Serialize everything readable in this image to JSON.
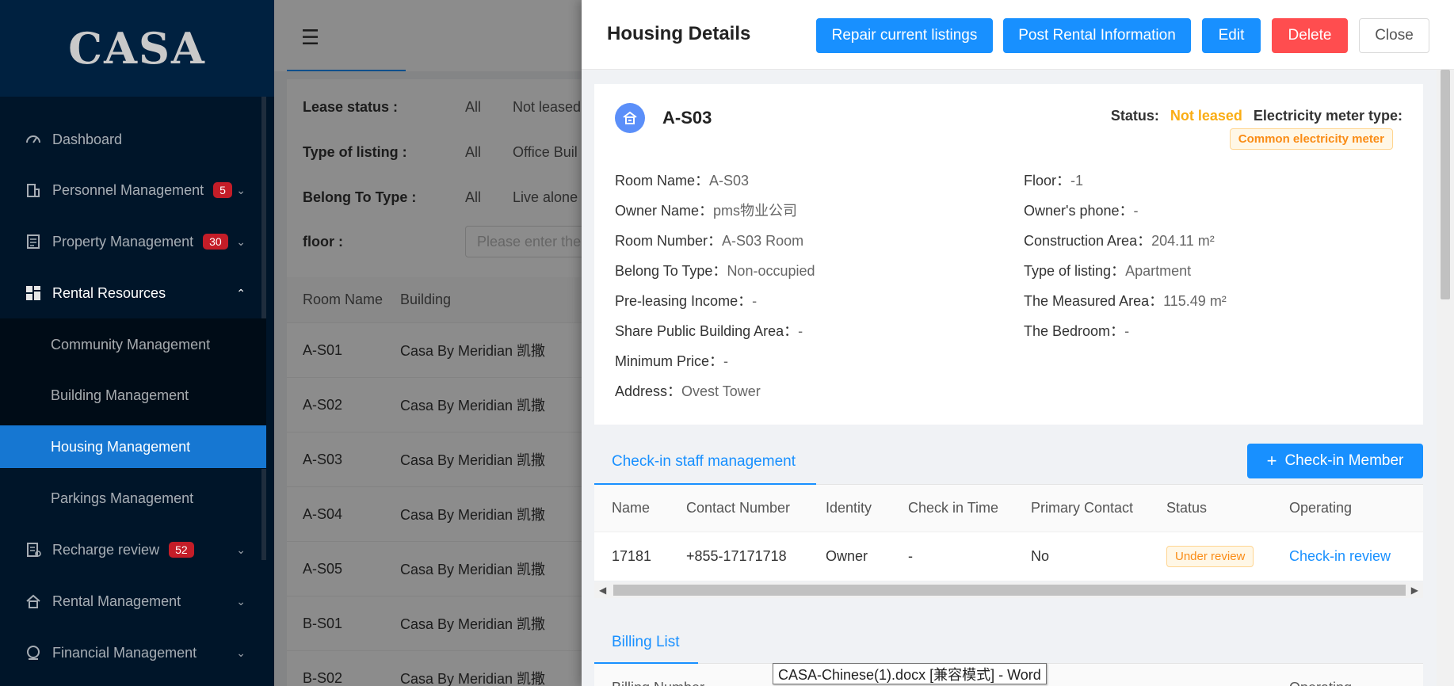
{
  "sidebar": {
    "logo": "CASA",
    "menu": [
      {
        "label": "Dashboard",
        "badge": "",
        "icon": "dashboard-icon"
      },
      {
        "label": "Personnel Management",
        "badge": "5",
        "icon": "building-icon"
      },
      {
        "label": "Property Management",
        "badge": "30",
        "icon": "document-icon"
      },
      {
        "label": "Rental Resources",
        "badge": "",
        "icon": "grid-icon"
      },
      {
        "label": "Recharge review",
        "badge": "52",
        "icon": "receipt-icon"
      },
      {
        "label": "Rental Management",
        "badge": "",
        "icon": "house-icon"
      },
      {
        "label": "Financial Management",
        "badge": "",
        "icon": "finance-icon"
      }
    ],
    "submenu": [
      {
        "label": "Community Management"
      },
      {
        "label": "Building Management"
      },
      {
        "label": "Housing Management"
      },
      {
        "label": "Parkings Management"
      }
    ]
  },
  "filters": {
    "lease_status": {
      "label": "Lease status :",
      "options": [
        "All",
        "Not leased"
      ]
    },
    "listing_type": {
      "label": "Type of listing :",
      "options": [
        "All",
        "Office Buil"
      ]
    },
    "belong_type": {
      "label": "Belong To Type :",
      "options": [
        "All",
        "Live alone"
      ]
    },
    "floor": {
      "label": "floor :",
      "placeholder": "Please enter the"
    }
  },
  "list": {
    "headers": [
      "Room Name",
      "Building"
    ],
    "rows": [
      {
        "room": "A-S01",
        "building": "Casa By Meridian 凯撒"
      },
      {
        "room": "A-S02",
        "building": "Casa By Meridian 凯撒"
      },
      {
        "room": "A-S03",
        "building": "Casa By Meridian 凯撒"
      },
      {
        "room": "A-S04",
        "building": "Casa By Meridian 凯撒"
      },
      {
        "room": "A-S05",
        "building": "Casa By Meridian 凯撒"
      },
      {
        "room": "B-S01",
        "building": "Casa By Meridian 凯撒"
      },
      {
        "room": "B-S02",
        "building": "Casa By Meridian 凯撒"
      }
    ]
  },
  "drawer": {
    "title": "Housing Details",
    "buttons": {
      "repair": "Repair current listings",
      "post": "Post Rental Information",
      "edit": "Edit",
      "delete": "Delete",
      "close": "Close"
    },
    "room_title": "A-S03",
    "status_label": "Status:",
    "status_value": "Not leased",
    "meter_label": "Electricity meter type:",
    "meter_value": "Common electricity meter",
    "fields_left": [
      {
        "label": "Room Name：",
        "value": "A-S03"
      },
      {
        "label": "Owner Name：",
        "value": "pms物业公司"
      },
      {
        "label": "Room Number：",
        "value": "A-S03 Room"
      },
      {
        "label": "Belong To Type：",
        "value": "Non-occupied"
      },
      {
        "label": "Pre-leasing Income：",
        "value": "-"
      },
      {
        "label": "Share Public Building Area：",
        "value": "-"
      },
      {
        "label": "Minimum Price：",
        "value": "-"
      },
      {
        "label": "Address：",
        "value": "Ovest Tower"
      }
    ],
    "fields_right": [
      {
        "label": "Floor：",
        "value": "-1"
      },
      {
        "label": "Owner's phone：",
        "value": "-"
      },
      {
        "label": "Construction Area：",
        "value": "204.11 m²"
      },
      {
        "label": "Type of listing：",
        "value": "Apartment"
      },
      {
        "label": "The Measured Area：",
        "value": "115.49 m²"
      },
      {
        "label": "The Bedroom：",
        "value": "-"
      }
    ],
    "staff": {
      "tab": "Check-in staff management",
      "add_button": "Check-in Member",
      "headers": [
        "Name",
        "Contact Number",
        "Identity",
        "Check in Time",
        "Primary Contact",
        "Status",
        "Operating"
      ],
      "rows": [
        {
          "name": "17181",
          "phone": "+855-17171718",
          "identity": "Owner",
          "time": "-",
          "primary": "No",
          "status": "Under review",
          "op": "Check-in review"
        }
      ]
    },
    "billing": {
      "tab": "Billing List",
      "headers": [
        "Billing Number",
        "Operating"
      ]
    }
  },
  "taskbar_tooltip": "CASA-Chinese(1).docx [兼容模式] - Word",
  "colors": {
    "primary": "#1890ff",
    "danger": "#ff4d4f",
    "warning": "#faad14",
    "sidebar": "#001529"
  }
}
